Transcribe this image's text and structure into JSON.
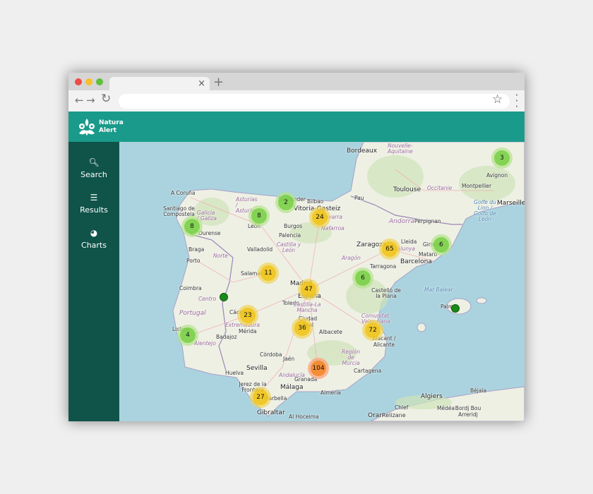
{
  "browser": {
    "tab_close": "×",
    "new_tab": "+",
    "back": "←",
    "forward": "→",
    "reload": "↻",
    "url": "",
    "star_icon": "☆",
    "menu_icon": "⋮"
  },
  "app": {
    "brand_line1": "Natura",
    "brand_line2": "Alert",
    "header_color": "#1a9a8a",
    "sidebar_color": "#0f5349"
  },
  "sidebar": {
    "items": [
      {
        "label": "Search",
        "icon": "search-icon"
      },
      {
        "label": "Results",
        "icon": "list-icon"
      },
      {
        "label": "Charts",
        "icon": "pie-chart-icon"
      }
    ]
  },
  "map": {
    "labels": [
      "Bordeaux",
      "Nouvelle-Aquitaine",
      "Toulouse",
      "Occitanie",
      "Montpellier",
      "Avignon",
      "Marseille",
      "Pau",
      "Perpignan",
      "Andorra",
      "A Coruña",
      "Santiago de Compostela",
      "Galicia / Galiza",
      "Ourense",
      "Asturias / Asturies",
      "Santander",
      "Bilbao",
      "Vitoria-Gasteiz",
      "Navarra / Nafarroa",
      "León",
      "Burgos",
      "Palencia",
      "Valladolid",
      "Castilla y León",
      "Zaragoza",
      "Lleida",
      "Catalunya",
      "Girona",
      "Mataró",
      "Barcelona",
      "Tarragona",
      "Aragón",
      "Braga",
      "Norte",
      "Porto",
      "Salamanca",
      "Madrid",
      "España",
      "Coimbra",
      "Centro",
      "Toledo",
      "Castilla-La Mancha",
      "Castelló de la Plana",
      "Mar Balear",
      "Palma",
      "Portugal",
      "Cáceres",
      "Extremadura",
      "Ciudad Real",
      "Mérida",
      "Badajoz",
      "Albacete",
      "Comunitat Valenciana",
      "Alacant / Alicante",
      "Lisboa",
      "Alentejo",
      "Córdoba",
      "Jaén",
      "Región de Murcia",
      "Sevilla",
      "Huelva",
      "Andalucía",
      "Granada",
      "Cartagena",
      "Jerez de la Frontera",
      "Málaga",
      "Almería",
      "Marbella",
      "Gibraltar",
      "Al Hoceima",
      "Oran",
      "Algiers",
      "Béjaïa",
      "Médéa",
      "Chlef",
      "Bordj Bou Arreridj",
      "Relizane",
      "Golfe du Lion / Golfo de León"
    ],
    "clusters": [
      {
        "count": "3",
        "level": "small"
      },
      {
        "count": "2",
        "level": "small"
      },
      {
        "count": "8",
        "level": "small"
      },
      {
        "count": "24",
        "level": "medium"
      },
      {
        "count": "8",
        "level": "small"
      },
      {
        "count": "65",
        "level": "medium"
      },
      {
        "count": "6",
        "level": "small"
      },
      {
        "count": "11",
        "level": "medium"
      },
      {
        "count": "6",
        "level": "small"
      },
      {
        "count": "47",
        "level": "medium"
      },
      {
        "count": "23",
        "level": "medium"
      },
      {
        "count": "36",
        "level": "medium"
      },
      {
        "count": "72",
        "level": "medium"
      },
      {
        "count": "4",
        "level": "small"
      },
      {
        "count": "104",
        "level": "large"
      },
      {
        "count": "27",
        "level": "medium"
      }
    ],
    "single_markers": 2,
    "colors": {
      "small_outer": "rgba(181,226,140,0.7)",
      "small_inner": "rgba(110,204,57,0.75)",
      "medium_outer": "rgba(241,211,87,0.7)",
      "medium_inner": "rgba(240,194,12,0.75)",
      "large_outer": "rgba(253,156,115,0.7)",
      "large_inner": "rgba(241,128,23,0.75)",
      "marker": "#1a8a1a",
      "sea": "#aad3df",
      "land": "#eef0e4"
    }
  }
}
